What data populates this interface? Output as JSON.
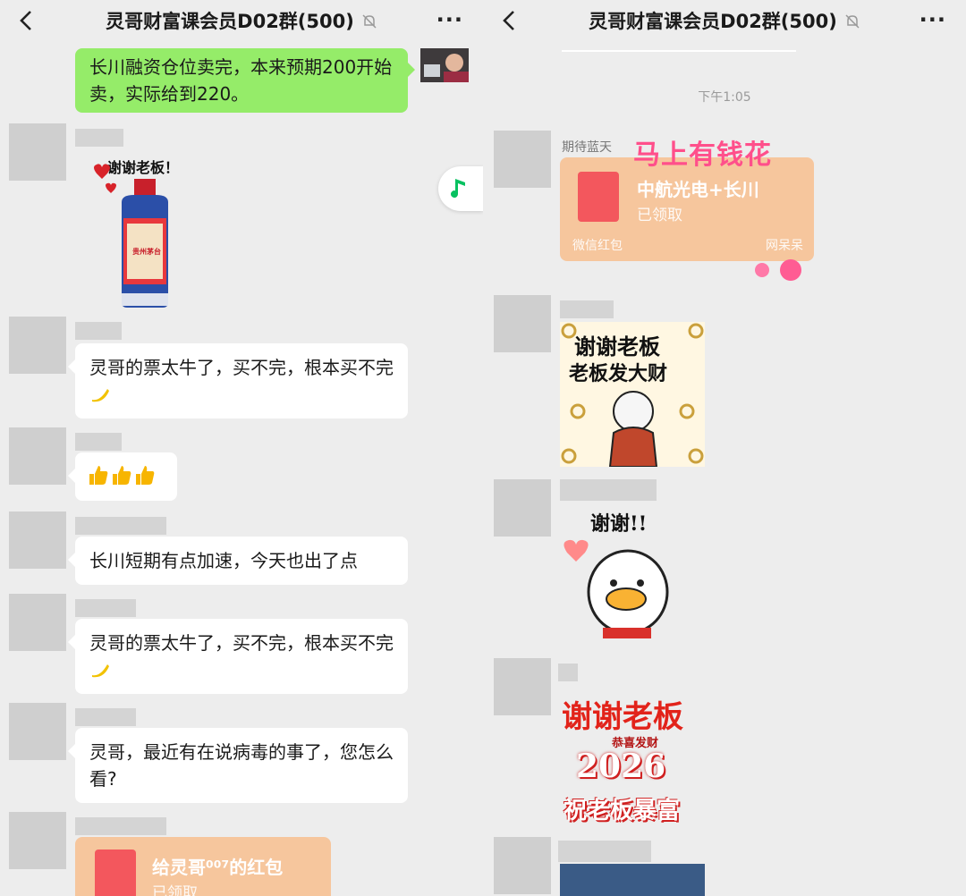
{
  "left": {
    "header": {
      "title": "灵哥财富课会员D02群(500)",
      "back_label": "‹",
      "more_label": "···"
    },
    "messages": {
      "self_text": "长川融资仓位卖完，本来预期200开始卖，实际给到220。",
      "sticker1_text": "谢谢老板！",
      "bottle_label": "贵州茅台",
      "m2": "灵哥的票太牛了，买不完，根本买不完",
      "m4": "长川短期有点加速，今天也出了点",
      "m5": "灵哥的票太牛了，买不完，根本买不完",
      "m6": "灵哥，最近有在说病毒的事了，您怎么看?",
      "redpacket": {
        "title": "给灵哥⁰⁰⁷的红包",
        "status": "已领取"
      }
    }
  },
  "right": {
    "header": {
      "title": "灵哥财富课会员D02群(500)",
      "back_label": "‹",
      "more_label": "···"
    },
    "time": "下午1:05",
    "redpacket": {
      "sender": "期待蓝天",
      "banner": "马上有钱花",
      "title": "中航光电+长川",
      "status": "已领取",
      "footer_left": "微信红包",
      "footer_right": "网呆呆"
    },
    "sticker1": {
      "line1": "谢谢老板",
      "line2": "老板发大财"
    },
    "sticker2": {
      "text": "谢谢!!"
    },
    "sticker3": {
      "line1": "谢谢老板",
      "sub": "恭喜发财",
      "year": "2026",
      "line2": "祝老板暴富"
    }
  },
  "colors": {
    "bg": "#ededed",
    "green_bubble": "#95ec69",
    "redpacket": "#f6c69d",
    "redpacket_icon": "#f3575d"
  },
  "icons": [
    "back-icon",
    "mute-bell-icon",
    "more-icon",
    "music-note-icon",
    "thumbs-up-icon",
    "banana-icon"
  ]
}
